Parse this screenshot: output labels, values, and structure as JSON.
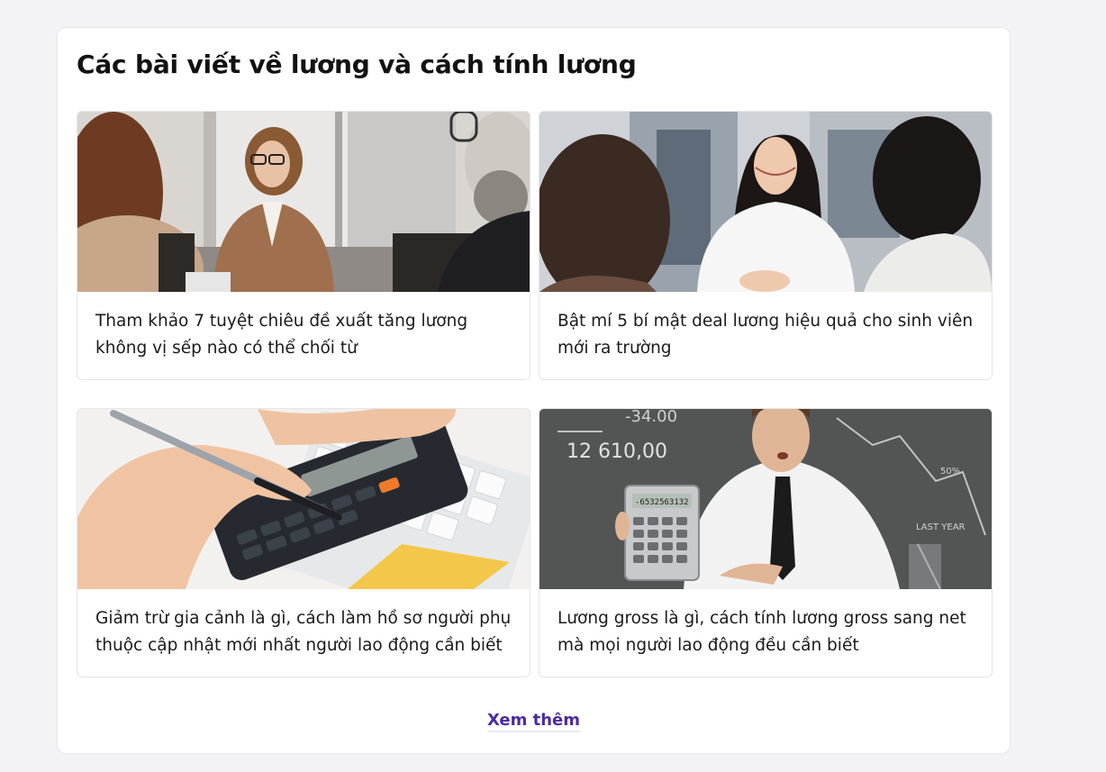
{
  "section": {
    "title": "Các bài viết về lương và cách tính lương",
    "more_link": "Xem thêm"
  },
  "articles": [
    {
      "title": "Tham khảo 7 tuyệt chiêu đề xuất tăng lương không vị sếp nào có thể chối từ",
      "image": "job-interview-woman-photo"
    },
    {
      "title": "Bật mí 5 bí mật deal lương hiệu quả cho sinh viên mới ra trường",
      "image": "smiling-candidate-interview-photo"
    },
    {
      "title": "Giảm trừ gia cảnh là gì, cách làm hồ sơ người phụ thuộc cập nhật mới nhất người lao động cần biết",
      "image": "hand-using-calculator-photo"
    },
    {
      "title": "Lương gross là gì, cách tính lương gross sang net mà mọi người lao động đều cần biết",
      "image": "man-holding-calculator-photo"
    }
  ],
  "photo_text": {
    "chalk_number": "12 610,00",
    "chalk_top": "-34.00",
    "calculator_display": "-6532563132",
    "chalk_last_year": "LAST YEAR",
    "chalk_pct": "50%"
  },
  "colors": {
    "link": "#4b2aa3",
    "card_border": "#e6e6ea",
    "page_bg": "#f3f3f5"
  }
}
